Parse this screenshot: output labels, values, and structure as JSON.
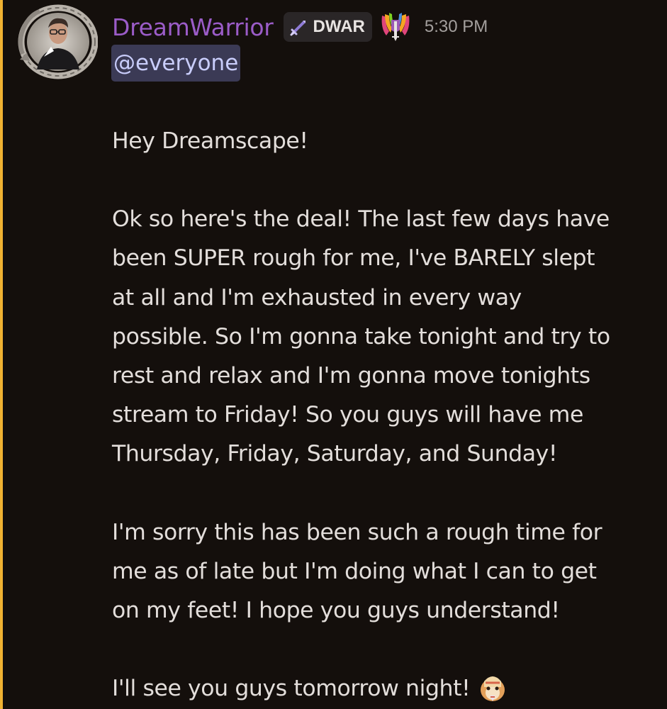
{
  "message": {
    "author": {
      "name": "DreamWarrior",
      "name_color": "#9b5cc8",
      "avatar_icon": "avatar-image",
      "tag": {
        "icon": "sword-icon",
        "text": "DWAR"
      },
      "role_icon": "rainbow-warrior-icon"
    },
    "timestamp": "5:30 PM",
    "mention": "@everyone",
    "lines": [
      "Hey Dreamscape!",
      "",
      "Ok so here's the deal! The last few days have",
      "been SUPER rough for me, I've BARELY slept",
      "at all and I'm exhausted in every way",
      "possible. So I'm gonna take tonight and try to",
      "rest and relax and I'm gonna move tonights",
      "stream to Friday! So you guys will have me",
      "Thursday, Friday, Saturday, and Sunday!",
      "",
      "I'm sorry this has been such a rough time for",
      "me as of late but I'm doing what I can to get",
      "on my feet! I hope you guys understand!",
      "",
      "I'll see you guys tomorrow night!"
    ],
    "trailing_emoji": "hamster-emoji",
    "highlight_color": "#f0b232"
  }
}
